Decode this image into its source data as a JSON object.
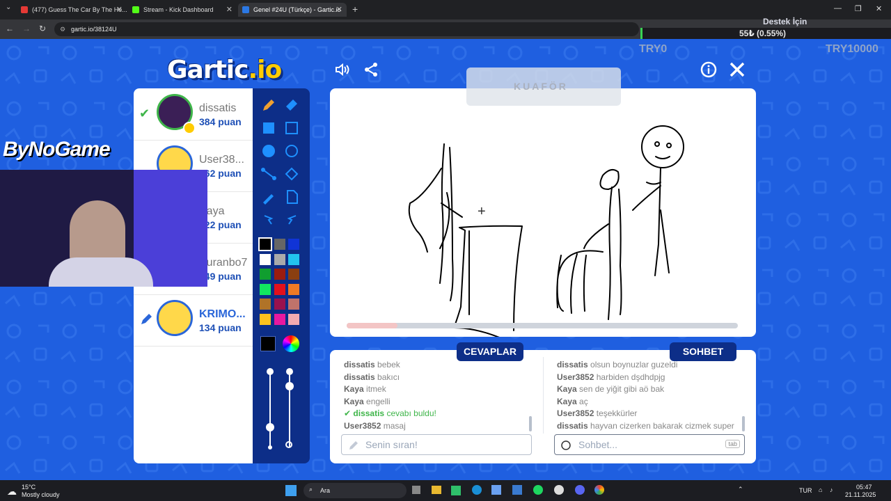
{
  "browser": {
    "tabs": [
      {
        "title": "(477) Guess The Car By The He...",
        "active": false,
        "favicon_color": "#e53935"
      },
      {
        "title": "Stream - Kick Dashboard",
        "active": false,
        "favicon_color": "#53fc18"
      },
      {
        "title": "Genel #24U (Türkçe) - Gartic.io",
        "active": true,
        "favicon_color": "#2b78e4"
      }
    ],
    "url": "gartic.io/38124U"
  },
  "overlay": {
    "donate_title": "Destek İçin",
    "donate_amount": "55₺ (0.55%)",
    "donate_progress": 0.0055,
    "min_label": "TRY0",
    "max_label": "TRY10000",
    "sponsor": "ByNoGame"
  },
  "game": {
    "logo_main": "Gartic",
    "logo_suffix": ".io",
    "word_hint": "KUAFÖR",
    "timer_progress": 0.13,
    "colors": {
      "accent": "#0d2e88",
      "background": "#1f5fe0",
      "success": "#3fb54a"
    }
  },
  "players": [
    {
      "name": "dissatis",
      "points": "384 puan",
      "status": "guessed",
      "avatar": "character-avatar"
    },
    {
      "name": "User38...",
      "points": "262 puan",
      "status": "",
      "avatar": "default-avatar"
    },
    {
      "name": "Kaya",
      "points": "222 puan",
      "status": "",
      "avatar": "default-avatar"
    },
    {
      "name": "Kuranbo7",
      "points": "149 puan",
      "status": "",
      "avatar": "default-avatar"
    },
    {
      "name": "KRIMO...",
      "points": "134 puan",
      "status": "drawing",
      "avatar": "default-avatar"
    }
  ],
  "palette": [
    "#000000",
    "#666666",
    "#1034d6",
    "#ffffff",
    "#aaaaaa",
    "#22c4ee",
    "#109e2f",
    "#9a1c0f",
    "#8a3f10",
    "#12e860",
    "#e3101c",
    "#ef7a25",
    "#b07328",
    "#99124e",
    "#c0736b",
    "#fcc11e",
    "#e818a0",
    "#f3aab0"
  ],
  "answers": {
    "tab_label": "CEVAPLAR",
    "messages": [
      {
        "user": "dissatis",
        "text": "bebek",
        "correct": false
      },
      {
        "user": "dissatis",
        "text": "bakıcı",
        "correct": false
      },
      {
        "user": "Kaya",
        "text": "itmek",
        "correct": false
      },
      {
        "user": "Kaya",
        "text": "engelli",
        "correct": false
      },
      {
        "user": "dissatis",
        "text": "cevabı buldu!",
        "correct": true
      },
      {
        "user": "User3852",
        "text": "masaj",
        "correct": false
      }
    ],
    "placeholder": "Senin sıran!"
  },
  "chat": {
    "tab_label": "SOHBET",
    "messages": [
      {
        "user": "dissatis",
        "text": "olsun boynuzlar guzeldi"
      },
      {
        "user": "User3852",
        "text": "harbiden dşdhdpjg"
      },
      {
        "user": "Kaya",
        "text": "sen de yiğit gibi aö bak"
      },
      {
        "user": "Kaya",
        "text": "aç"
      },
      {
        "user": "User3852",
        "text": "teşekkürler"
      },
      {
        "user": "dissatis",
        "text": "hayvan cizerken bakarak cizmek super"
      }
    ],
    "placeholder": "Sohbet...",
    "tab_hint": "tab"
  },
  "taskbar": {
    "weather_temp": "15°C",
    "weather_desc": "Mostly cloudy",
    "search_label": "Ara",
    "language": "TUR",
    "time": "05:47",
    "date": "21.11.2025"
  }
}
